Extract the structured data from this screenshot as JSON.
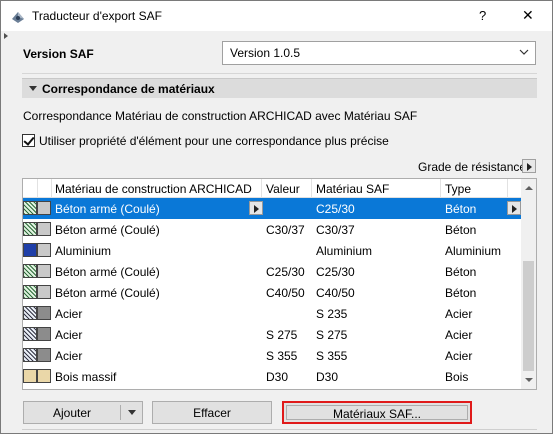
{
  "window": {
    "title": "Traducteur d'export SAF",
    "help": "?",
    "close": "✕"
  },
  "version": {
    "label": "Version SAF",
    "selected": "Version 1.0.5"
  },
  "section": {
    "title": "Correspondance de matériaux",
    "description": "Correspondance Matériau de construction ARCHICAD avec Matériau SAF",
    "checkbox_label": "Utiliser propriété d'élément pour une correspondance plus précise",
    "checkbox_checked": true,
    "grade_label": "Grade de résistance"
  },
  "table": {
    "headers": [
      "Matériau de construction ARCHICAD",
      "Valeur",
      "Matériau SAF",
      "Type"
    ],
    "rows": [
      {
        "material": "Béton armé (Coulé)",
        "value": "",
        "saf": "C25/30",
        "type": "Béton",
        "swatch": "hatch-green",
        "selected": true
      },
      {
        "material": "Béton armé (Coulé)",
        "value": "C30/37",
        "saf": "C30/37",
        "type": "Béton",
        "swatch": "hatch-green",
        "selected": false
      },
      {
        "material": "Aluminium",
        "value": "",
        "saf": "Aluminium",
        "type": "Aluminium",
        "swatch": "solid-blue",
        "selected": false
      },
      {
        "material": "Béton armé (Coulé)",
        "value": "C25/30",
        "saf": "C25/30",
        "type": "Béton",
        "swatch": "hatch-green",
        "selected": false
      },
      {
        "material": "Béton armé (Coulé)",
        "value": "C40/50",
        "saf": "C40/50",
        "type": "Béton",
        "swatch": "hatch-green",
        "selected": false
      },
      {
        "material": "Acier",
        "value": "",
        "saf": "S 235",
        "type": "Acier",
        "swatch": "hatch-steel",
        "selected": false
      },
      {
        "material": "Acier",
        "value": "S 275",
        "saf": "S 275",
        "type": "Acier",
        "swatch": "hatch-steel",
        "selected": false
      },
      {
        "material": "Acier",
        "value": "S 355",
        "saf": "S 355",
        "type": "Acier",
        "swatch": "hatch-steel",
        "selected": false
      },
      {
        "material": "Bois massif",
        "value": "D30",
        "saf": "D30",
        "type": "Bois",
        "swatch": "wood",
        "selected": false
      }
    ]
  },
  "buttons": {
    "add": "Ajouter",
    "clear": "Effacer",
    "saf_materials": "Matériaux SAF..."
  },
  "colors": {
    "selection": "#0a78d7",
    "highlight_border": "#e01a1a"
  }
}
